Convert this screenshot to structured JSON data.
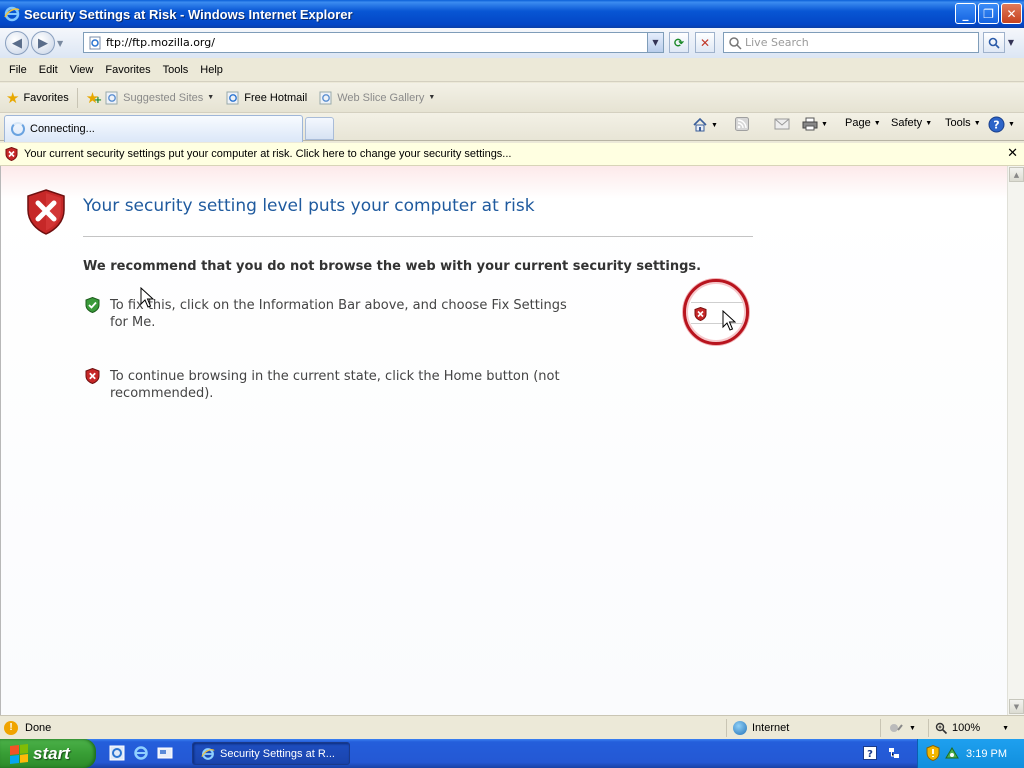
{
  "window": {
    "title": "Security Settings at Risk - Windows Internet Explorer",
    "minimize": "_",
    "restore": "❐",
    "close": "✕"
  },
  "address_bar": {
    "url": "ftp://ftp.mozilla.org/",
    "search_placeholder": "Live Search"
  },
  "menu": [
    "File",
    "Edit",
    "View",
    "Favorites",
    "Tools",
    "Help"
  ],
  "favorites_bar": {
    "favorites_label": "Favorites",
    "links": [
      {
        "label": "Suggested Sites",
        "dim": true,
        "dropdown": true
      },
      {
        "label": "Free Hotmail",
        "dim": false,
        "dropdown": false
      },
      {
        "label": "Web Slice Gallery",
        "dim": true,
        "dropdown": true
      }
    ]
  },
  "tab": {
    "title": "Connecting..."
  },
  "command_bar": {
    "page": "Page",
    "safety": "Safety",
    "tools": "Tools"
  },
  "info_bar": {
    "text": "Your current security settings put your computer at risk. Click here to change your security settings..."
  },
  "content": {
    "heading": "Your security setting level puts your computer at risk",
    "recommend": "We recommend that you do not browse the web with your current security settings.",
    "item1": "To fix this, click on the Information Bar above, and choose Fix Settings for Me.",
    "item2": "To continue browsing in the current state, click the Home button (not recommended)."
  },
  "status_bar": {
    "status": "Done",
    "zone": "Internet",
    "zoom": "100%"
  },
  "taskbar": {
    "start": "start",
    "task_item": "Security Settings at R...",
    "clock": "3:19 PM"
  },
  "colors": {
    "heading": "#1f5a9e",
    "info_bar_bg": "#ffffe1",
    "titlebar": "#0856d4",
    "start_button": "#389e35",
    "alert_red": "#c62828"
  }
}
